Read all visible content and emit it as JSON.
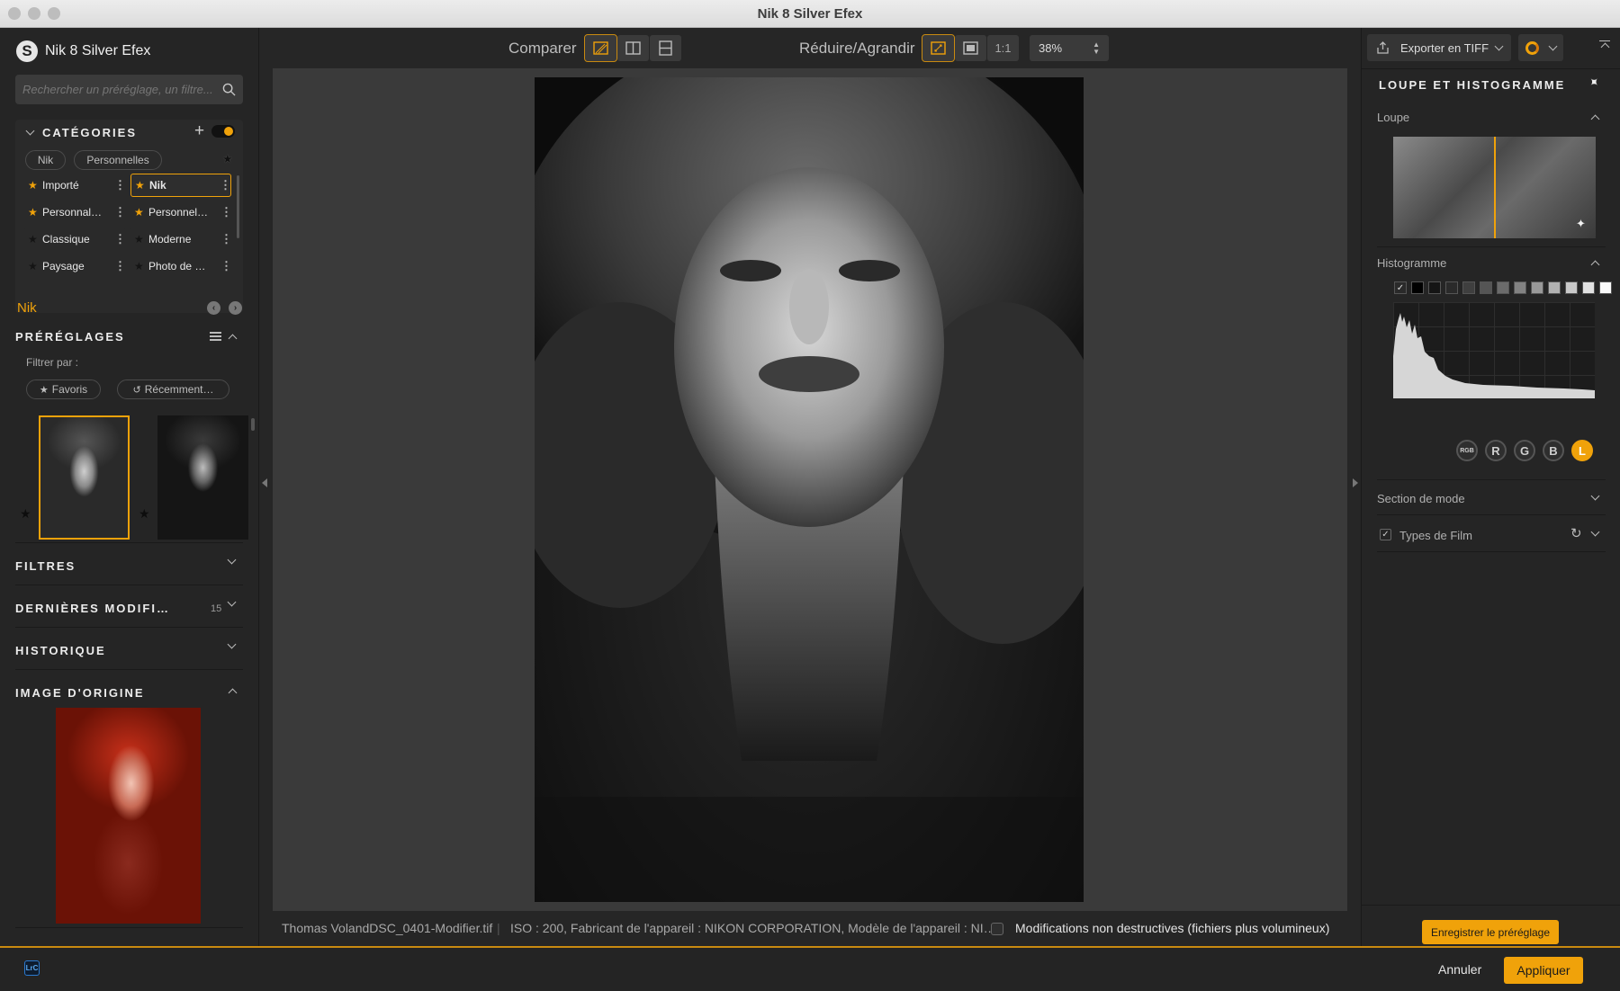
{
  "window": {
    "title": "Nik 8 Silver Efex"
  },
  "app": {
    "name": "Nik 8 Silver Efex",
    "logo_letter": "S"
  },
  "search": {
    "placeholder": "Rechercher un préréglage, un filtre..."
  },
  "categories": {
    "title": "CATÉGORIES",
    "tabs": [
      "Nik",
      "Personnelles"
    ],
    "items": [
      {
        "label": "Importé",
        "starred": true,
        "selected": false
      },
      {
        "label": "Nik",
        "starred": true,
        "selected": true
      },
      {
        "label": "Personnal…",
        "starred": true,
        "selected": false
      },
      {
        "label": "Personnel…",
        "starred": true,
        "selected": false
      },
      {
        "label": "Classique",
        "starred": false,
        "selected": false
      },
      {
        "label": "Moderne",
        "starred": false,
        "selected": false
      },
      {
        "label": "Paysage",
        "starred": false,
        "selected": false
      },
      {
        "label": "Photo de …",
        "starred": false,
        "selected": false
      }
    ]
  },
  "presets": {
    "group_label": "Nik",
    "title": "PRÉRÉGLAGES",
    "filter_label": "Filtrer par :",
    "filter_favorites": "Favoris",
    "filter_recent": "Récemment…"
  },
  "sections": {
    "filters": "FILTRES",
    "last_changes": "DERNIÈRES MODIFI…",
    "last_changes_count": "15",
    "history": "HISTORIQUE",
    "original": "IMAGE D'ORIGINE"
  },
  "toolbar": {
    "compare_label": "Comparer",
    "zoom_label": "Réduire/Agrandir",
    "one_to_one": "1:1",
    "zoom_value": "38%"
  },
  "status": {
    "filename": "Thomas VolandDSC_0401-Modifier.tif",
    "metadata": "ISO : 200, Fabricant de l'appareil : NIKON CORPORATION, Modèle de l'appareil : NI…",
    "nondestructive_label": "Modifications non destructives (fichiers plus volumineux)"
  },
  "right_panel": {
    "export_label": "Exporter en TIFF",
    "panel_title": "LOUPE ET HISTOGRAMME",
    "loupe": "Loupe",
    "histogram": "Histogramme",
    "channels": [
      "RGB",
      "R",
      "G",
      "B",
      "L"
    ],
    "active_channel": "L",
    "mode_section": "Section de mode",
    "film_types": "Types de Film",
    "save_preset": "Enregistrer le préréglage"
  },
  "footer": {
    "lrc_badge": "LrC",
    "cancel": "Annuler",
    "apply": "Appliquer"
  },
  "colors": {
    "accent": "#f0a20a",
    "panel": "#252525",
    "canvas": "#3a3a3a"
  }
}
